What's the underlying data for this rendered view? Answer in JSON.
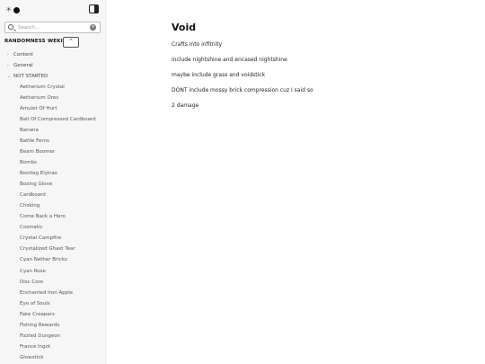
{
  "sidebar": {
    "search_placeholder": "Search...",
    "wiki_title": "RANDOMNESS WEKI!",
    "collapse_glyph": "⌃",
    "folders": [
      {
        "label": "Content",
        "expanded": false
      },
      {
        "label": "General",
        "expanded": false
      },
      {
        "label": "NOT STARTED",
        "expanded": true
      }
    ],
    "pages": [
      "Aetherium Crystal",
      "Aetherium Ores",
      "Amulet Of Hurt",
      "Ball Of Compressed Cardboard",
      "Banana",
      "Battle Ferns",
      "Beam Boomer",
      "Bombs",
      "Bootleg Elytras",
      "Boxing Glove",
      "Cardboard",
      "Choking",
      "Come Back a Hero",
      "Cosmatic",
      "Crystal Campfire",
      "Crystalized Ghast Tear",
      "Cyan Nether Bricks",
      "Cyan Rose",
      "Disc Core",
      "Enchanted Iron Apple",
      "Eye of Souls",
      "Fake Creepers",
      "Fishing Rewards",
      "Fizzled Dungeon",
      "France Ingot",
      "Glowstick"
    ]
  },
  "page": {
    "title": "Void",
    "paragraphs": [
      "Crafts into infitnity",
      "include nightshine and encased nightshine",
      "maybe include grass and voidstick",
      "DONT include mossy brick compression cuz I said so",
      "2 damage"
    ]
  }
}
